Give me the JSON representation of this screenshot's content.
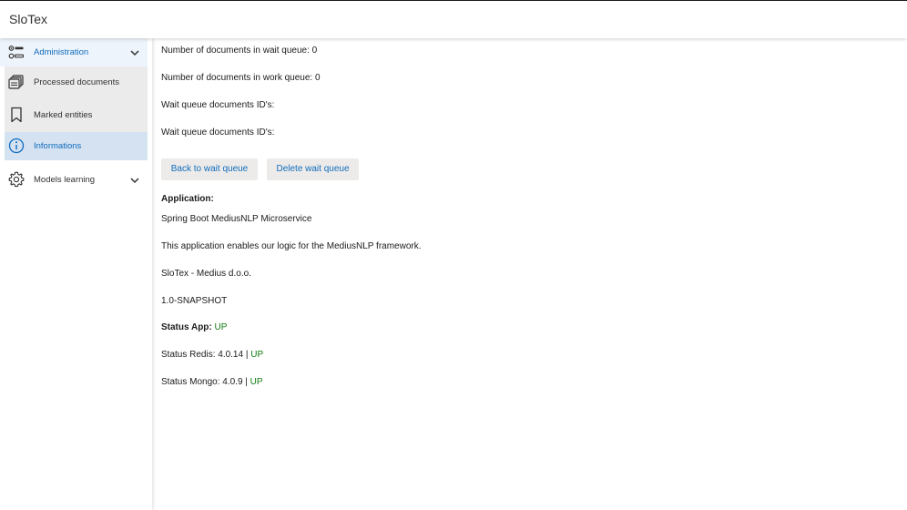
{
  "header": {
    "app_title": "SloTex"
  },
  "sidebar": {
    "items": [
      {
        "label": "Administration",
        "icon": "admin-list-icon",
        "expanded": true
      },
      {
        "label": "Processed documents",
        "icon": "documents-stack-icon"
      },
      {
        "label": "Marked entities",
        "icon": "bookmark-icon"
      },
      {
        "label": "Informations",
        "icon": "info-icon",
        "selected": true
      },
      {
        "label": "Models learning",
        "icon": "gear-icon",
        "expanded": false
      }
    ]
  },
  "main": {
    "wait_queue_count": "Number of documents in wait queue: 0",
    "work_queue_count": "Number of documents in work queue: 0",
    "wait_queue_ids_1": "Wait queue documents ID's:",
    "wait_queue_ids_2": "Wait queue documents ID's:",
    "buttons": {
      "back_to_wait_queue": "Back to wait queue",
      "delete_wait_queue": "Delete wait queue"
    },
    "application": {
      "heading": "Application:",
      "name": "Spring Boot MediusNLP Microservice",
      "description": "This application enables our logic for the MediusNLP framework.",
      "company": "SloTex - Medius d.o.o.",
      "version": "1.0-SNAPSHOT"
    },
    "status": {
      "app_label": "Status App:",
      "app_value": "UP",
      "redis_label": "Status Redis: 4.0.14 |",
      "redis_value": "UP",
      "mongo_label": "Status Mongo: 4.0.9 |",
      "mongo_value": "UP"
    }
  },
  "colors": {
    "accent": "#0f6cbd",
    "status_ok": "#107c10",
    "selected_bg": "#d5e2f2",
    "submenu_bg": "#ebebeb"
  }
}
